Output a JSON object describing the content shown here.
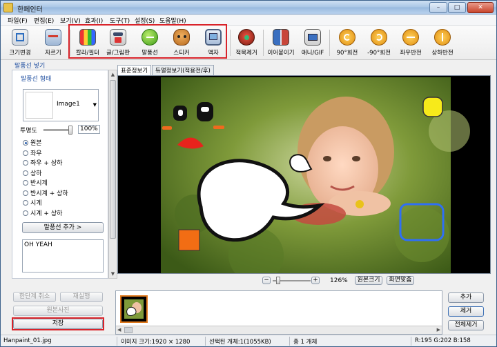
{
  "window": {
    "title": "한페인터",
    "minimize": "–",
    "maximize": "□",
    "close": "✕"
  },
  "menu": [
    "파일(F)",
    "편집(E)",
    "보기(V)",
    "효과(I)",
    "도구(T)",
    "설정(S)",
    "도움말(H)"
  ],
  "toolbar": [
    {
      "label": "크기변경",
      "icon": "resize-icon"
    },
    {
      "label": "자르기",
      "icon": "crop-icon"
    },
    {
      "label": "칼라/필터",
      "icon": "color-filter-icon"
    },
    {
      "label": "글/그림판",
      "icon": "text-draw-icon"
    },
    {
      "label": "말풍선",
      "icon": "speech-bubble-icon"
    },
    {
      "label": "스티커",
      "icon": "sticker-icon"
    },
    {
      "label": "액자",
      "icon": "frame-icon"
    },
    {
      "label": "적목제거",
      "icon": "red-eye-icon"
    },
    {
      "label": "이어붙이기",
      "icon": "merge-icon"
    },
    {
      "label": "애니/GIF",
      "icon": "gif-icon"
    },
    {
      "label": "90°회전",
      "icon": "rotate-cw-icon"
    },
    {
      "label": "-90°회전",
      "icon": "rotate-ccw-icon"
    },
    {
      "label": "좌우반전",
      "icon": "flip-h-icon"
    },
    {
      "label": "상하반전",
      "icon": "flip-v-icon"
    }
  ],
  "left_panel": {
    "section_title": "말풍선 넣기",
    "group_title": "말풍선 형태",
    "shape_value": "Image1",
    "opacity_label": "투명도",
    "opacity_value": "100%",
    "opacity_level": 1.0,
    "radio_options": [
      "원본",
      "좌우",
      "좌우 + 상하",
      "상하",
      "반시계",
      "반시계 + 상하",
      "시계",
      "시계 + 상하"
    ],
    "radio_selected": 0,
    "add_bubble_button": "말풍선 추가 >",
    "text_value": "OH YEAH",
    "undo_button": "한단계 취소",
    "redo_button": "재실행",
    "original_button": "원본사진",
    "save_button": "저장"
  },
  "view_tabs": [
    "표준정보기",
    "듀얼정보기(적용전/후)"
  ],
  "zoom": {
    "value": "126%",
    "fit_original": "원본크기",
    "fit_screen": "화면맞춤",
    "minus": "−",
    "plus": "+"
  },
  "right_buttons": {
    "add": "추가",
    "remove": "제거",
    "remove_all": "전체제거"
  },
  "status": {
    "filename": "Hanpaint_01.jpg",
    "image_size": "이미지 크기:1920 × 1280",
    "selected": "선택된 개체:1(1055KB)",
    "total": "총 1 개체",
    "color": "R:195 G:202 B:158"
  },
  "colors": {
    "highlight": "#d9232a",
    "accent": "#1f4fa0"
  }
}
